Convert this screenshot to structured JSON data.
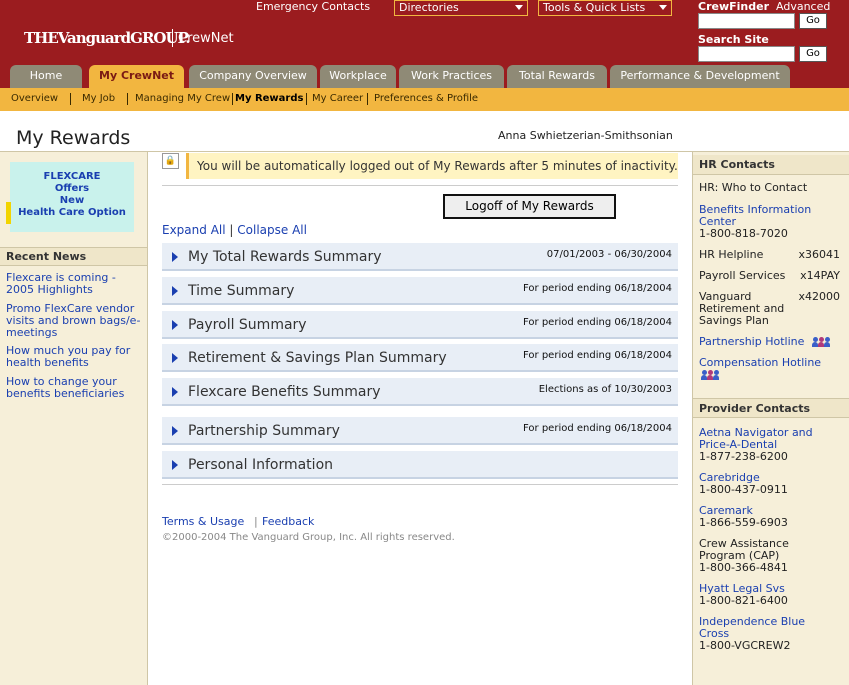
{
  "header": {
    "logo_main": "THEVanguardGROUP.",
    "app_name": "CrewNet",
    "emergency_contacts": "Emergency Contacts",
    "dropdown_directories": "Directories",
    "dropdown_tools": "Tools & Quick Lists",
    "crewfinder_label": "CrewFinder",
    "advanced_link": "Advanced",
    "search_label": "Search Site",
    "go_label": "Go"
  },
  "tabs": [
    {
      "label": "Home"
    },
    {
      "label": "My CrewNet"
    },
    {
      "label": "Company Overview"
    },
    {
      "label": "Workplace"
    },
    {
      "label": "Work Practices"
    },
    {
      "label": "Total Rewards"
    },
    {
      "label": "Performance & Development"
    }
  ],
  "subnav": [
    {
      "label": "Overview"
    },
    {
      "label": "My Job"
    },
    {
      "label": "Managing My Crew"
    },
    {
      "label": "My Rewards"
    },
    {
      "label": "My Career"
    },
    {
      "label": "Preferences & Profile"
    }
  ],
  "page": {
    "title": "My Rewards",
    "user_name": "Anna Swhietzerian-Smithsonian"
  },
  "promo": {
    "line1": "FLEXCARE",
    "line2": "Offers",
    "line3": "New",
    "line4": "Health Care Option"
  },
  "recent_news": {
    "header": "Recent News",
    "items": [
      {
        "text": "Flexcare is coming - 2005 Highlights"
      },
      {
        "text": "Promo FlexCare vendor visits and brown bags/e-meetings"
      },
      {
        "text": "How much you pay for health benefits"
      },
      {
        "text": "How to change your benefits beneficiaries"
      }
    ]
  },
  "main": {
    "notice": "You will be automatically logged out of My Rewards after 5 minutes of inactivity.",
    "logoff_button": "Logoff of My Rewards",
    "expand_all": "Expand All",
    "divider": "|",
    "collapse_all": "Collapse All",
    "sections": [
      {
        "label": "My Total Rewards Summary",
        "date": "07/01/2003 - 06/30/2004"
      },
      {
        "label": "Time Summary",
        "date": "For period ending 06/18/2004"
      },
      {
        "label": "Payroll Summary",
        "date": "For period ending 06/18/2004"
      },
      {
        "label": "Retirement & Savings Plan Summary",
        "date": "For period ending 06/18/2004"
      },
      {
        "label": "Flexcare Benefits Summary",
        "date": "Elections as of 10/30/2003"
      },
      {
        "label": "Partnership Summary",
        "date": "For period ending 06/18/2004"
      },
      {
        "label": "Personal Information",
        "date": ""
      }
    ]
  },
  "footer": {
    "terms": "Terms & Usage",
    "sep": "|",
    "feedback": "Feedback",
    "copyright": "©2000-2004 The Vanguard Group, Inc. All rights reserved."
  },
  "hr_contacts": {
    "header": "HR Contacts",
    "who": "HR: Who to Contact",
    "bic_name": "Benefits Information Center",
    "bic_phone": "1-800-818-7020",
    "helpline_name": "HR Helpline",
    "helpline_ext": "x36041",
    "payroll_name": "Payroll Services",
    "payroll_ext": "x14PAY",
    "vanguard_name": "Vanguard Retirement and Savings Plan",
    "vanguard_ext": "x42000",
    "partnership": "Partnership Hotline",
    "compensation": "Compensation Hotline"
  },
  "provider_contacts": {
    "header": "Provider Contacts",
    "items": [
      {
        "name": "Aetna Navigator and Price-A-Dental",
        "phone": "1-877-238-6200",
        "link": true
      },
      {
        "name": "Carebridge",
        "phone": "1-800-437-0911",
        "link": true
      },
      {
        "name": "Caremark",
        "phone": "1-866-559-6903",
        "link": true
      },
      {
        "name": "Crew Assistance Program (CAP)",
        "phone": "1-800-366-4841",
        "link": false
      },
      {
        "name": "Hyatt Legal Svs",
        "phone": "1-800-821-6400",
        "link": true
      },
      {
        "name": "Independence Blue Cross",
        "phone": "1-800-VGCREW2",
        "link": true
      }
    ]
  },
  "colors": {
    "header_red": "#9b1c1f",
    "accent_gold": "#f2b640",
    "tab_gray": "#8f8a76",
    "link_blue": "#1a3fb0",
    "section_bg": "#e8eef6"
  }
}
